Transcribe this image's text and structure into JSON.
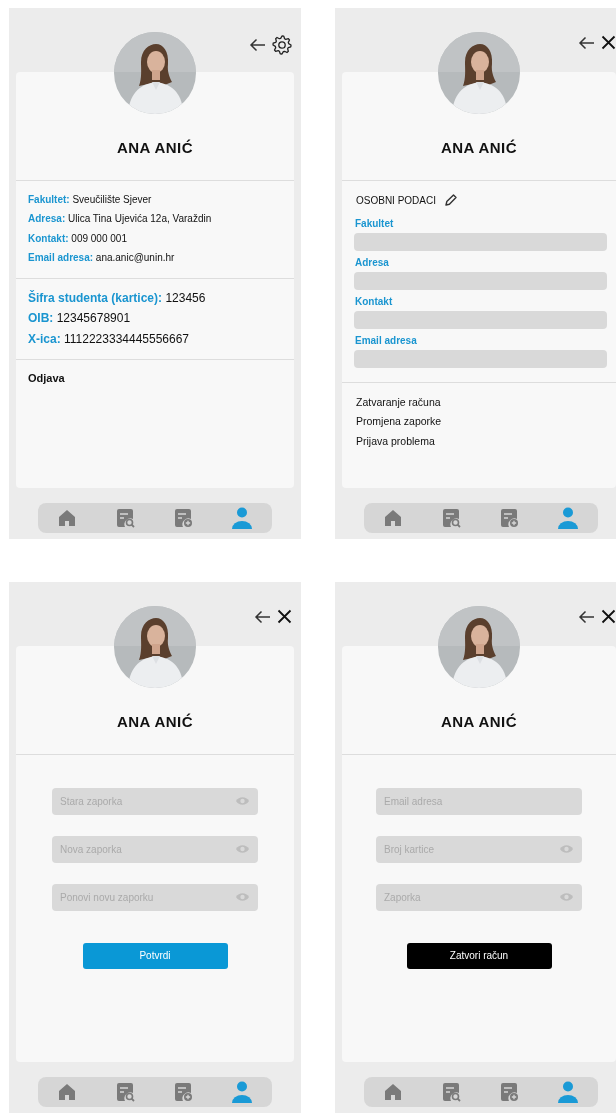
{
  "screens": [
    {
      "kind": "profile",
      "header_icons": [
        {
          "kind": "back"
        },
        {
          "kind": "settings"
        }
      ],
      "name": "ANA ANIĆ",
      "info_sections": [
        {
          "kind": "contact",
          "rows": [
            {
              "label": "Fakultet:",
              "value": "Sveučilište Sjever"
            },
            {
              "label": "Adresa:",
              "value": "Ulica Tina Ujevića 12a, Varaždin"
            },
            {
              "label": "Kontakt:",
              "value": "009 000 001"
            },
            {
              "label": "Email adresa:",
              "value": "ana.anic@unin.hr"
            }
          ]
        },
        {
          "kind": "student",
          "rows": [
            {
              "label": "Šifra studenta (kartice):",
              "value": "123456"
            },
            {
              "label": "OIB:",
              "value": "12345678901"
            },
            {
              "label": "X-ica:",
              "value": "1112223334445556667"
            }
          ]
        }
      ],
      "logout": "Odjava",
      "nav": [
        {
          "kind": "home",
          "selected": false
        },
        {
          "kind": "search",
          "selected": false
        },
        {
          "kind": "add",
          "selected": false
        },
        {
          "kind": "profile",
          "selected": true
        }
      ]
    },
    {
      "kind": "settings",
      "header_icons": [
        {
          "kind": "back"
        },
        {
          "kind": "close"
        }
      ],
      "name": "ANA ANIĆ",
      "section_title": "OSOBNI PODACI",
      "fields": [
        {
          "label": "Fakultet"
        },
        {
          "label": "Adresa"
        },
        {
          "label": "Kontakt"
        },
        {
          "label": "Email adresa"
        }
      ],
      "links": [
        "Zatvaranje računa",
        "Promjena zaporke",
        "Prijava problema"
      ],
      "nav": [
        {
          "kind": "home",
          "selected": false
        },
        {
          "kind": "search",
          "selected": false
        },
        {
          "kind": "add",
          "selected": false
        },
        {
          "kind": "profile",
          "selected": true
        }
      ]
    },
    {
      "kind": "form",
      "header_icons": [
        {
          "kind": "back"
        },
        {
          "kind": "close"
        }
      ],
      "name": "ANA ANIĆ",
      "inputs": [
        {
          "placeholder": "Stara zaporka",
          "reveal_icon": true
        },
        {
          "placeholder": "Nova zaporka",
          "reveal_icon": true
        },
        {
          "placeholder": "Ponovi novu zaporku",
          "reveal_icon": true
        }
      ],
      "button": {
        "label": "Potvrdi",
        "kind": "primary"
      },
      "nav": [
        {
          "kind": "home",
          "selected": false
        },
        {
          "kind": "search",
          "selected": false
        },
        {
          "kind": "add",
          "selected": false
        },
        {
          "kind": "profile",
          "selected": true
        }
      ]
    },
    {
      "kind": "form",
      "header_icons": [
        {
          "kind": "back"
        },
        {
          "kind": "close"
        }
      ],
      "name": "ANA ANIĆ",
      "inputs": [
        {
          "placeholder": "Email adresa",
          "reveal_icon": false
        },
        {
          "placeholder": "Broj kartice",
          "reveal_icon": true
        },
        {
          "placeholder": "Zaporka",
          "reveal_icon": true
        }
      ],
      "button": {
        "label": "Zatvori račun",
        "kind": "dark"
      },
      "nav": [
        {
          "kind": "home",
          "selected": false
        },
        {
          "kind": "search",
          "selected": false
        },
        {
          "kind": "add",
          "selected": false
        },
        {
          "kind": "profile",
          "selected": true
        }
      ]
    }
  ]
}
